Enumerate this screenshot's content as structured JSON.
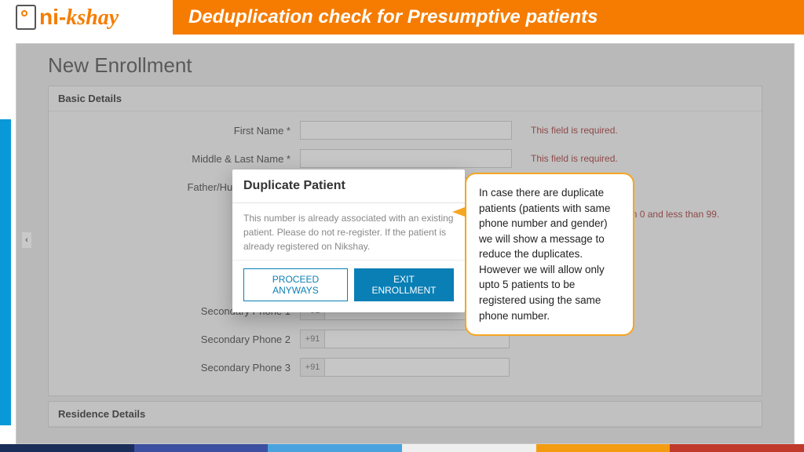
{
  "header": {
    "title": "Deduplication check for Presumptive patients",
    "logo_ni": "ni-",
    "logo_kshay": "kshay"
  },
  "page": {
    "title": "New Enrollment"
  },
  "panels": {
    "basic": {
      "title": "Basic Details"
    },
    "residence": {
      "title": "Residence Details"
    }
  },
  "form": {
    "first_name_label": "First Name *",
    "middle_last_label": "Middle & Last Name *",
    "father_husband_label": "Father/Husband Name",
    "sec_phone1_label": "Secondary Phone 1",
    "sec_phone2_label": "Secondary Phone 2",
    "sec_phone3_label": "Secondary Phone 3",
    "phone_prefix": "+91"
  },
  "errors": {
    "required": "This field is required.",
    "age_range": "Age must be greater than 0 and less than 99."
  },
  "modal": {
    "title": "Duplicate Patient",
    "body": "This number is already associated with an existing patient. Please do not re-register. If the patient is already registered on Nikshay.",
    "proceed": "PROCEED ANYWAYS",
    "exit": "EXIT ENROLLMENT"
  },
  "callout": {
    "text": "In case there are duplicate patients (patients with same phone number and gender) we will show a message to reduce the duplicates. However we will allow only upto 5 patients to be registered using the same phone number."
  },
  "collapse_glyph": "‹"
}
